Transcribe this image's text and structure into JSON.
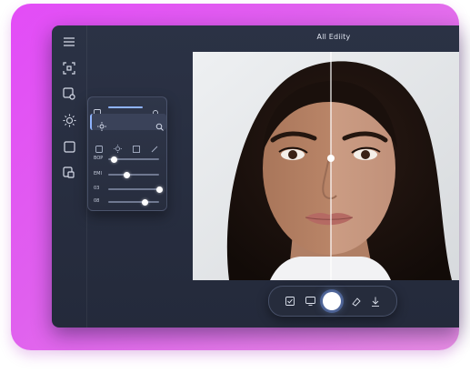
{
  "window": {
    "title": "All Ediity"
  },
  "sidebar": {
    "items": [
      {
        "icon": "menu-icon"
      },
      {
        "icon": "crop-frame-icon"
      },
      {
        "icon": "image-edit-icon"
      },
      {
        "icon": "brightness-icon"
      },
      {
        "icon": "square-icon"
      },
      {
        "icon": "layers-icon"
      }
    ]
  },
  "adjust_panel": {
    "sliders": [
      {
        "label": "BOP",
        "value": 0.12
      },
      {
        "label": "EMI",
        "value": 0.37
      },
      {
        "label": "03",
        "value": 1.0
      },
      {
        "label": "08",
        "value": 0.72
      }
    ]
  },
  "photo": {
    "compare_split": 0.52
  },
  "toolbar": {
    "buttons": [
      "checkbox-icon",
      "monitor-icon",
      "capture-button",
      "eraser-icon",
      "download-icon"
    ]
  },
  "colors": {
    "accent": "#8fb3ff",
    "backdrop": "#e34cf7",
    "app_bg": "#272d3e"
  }
}
